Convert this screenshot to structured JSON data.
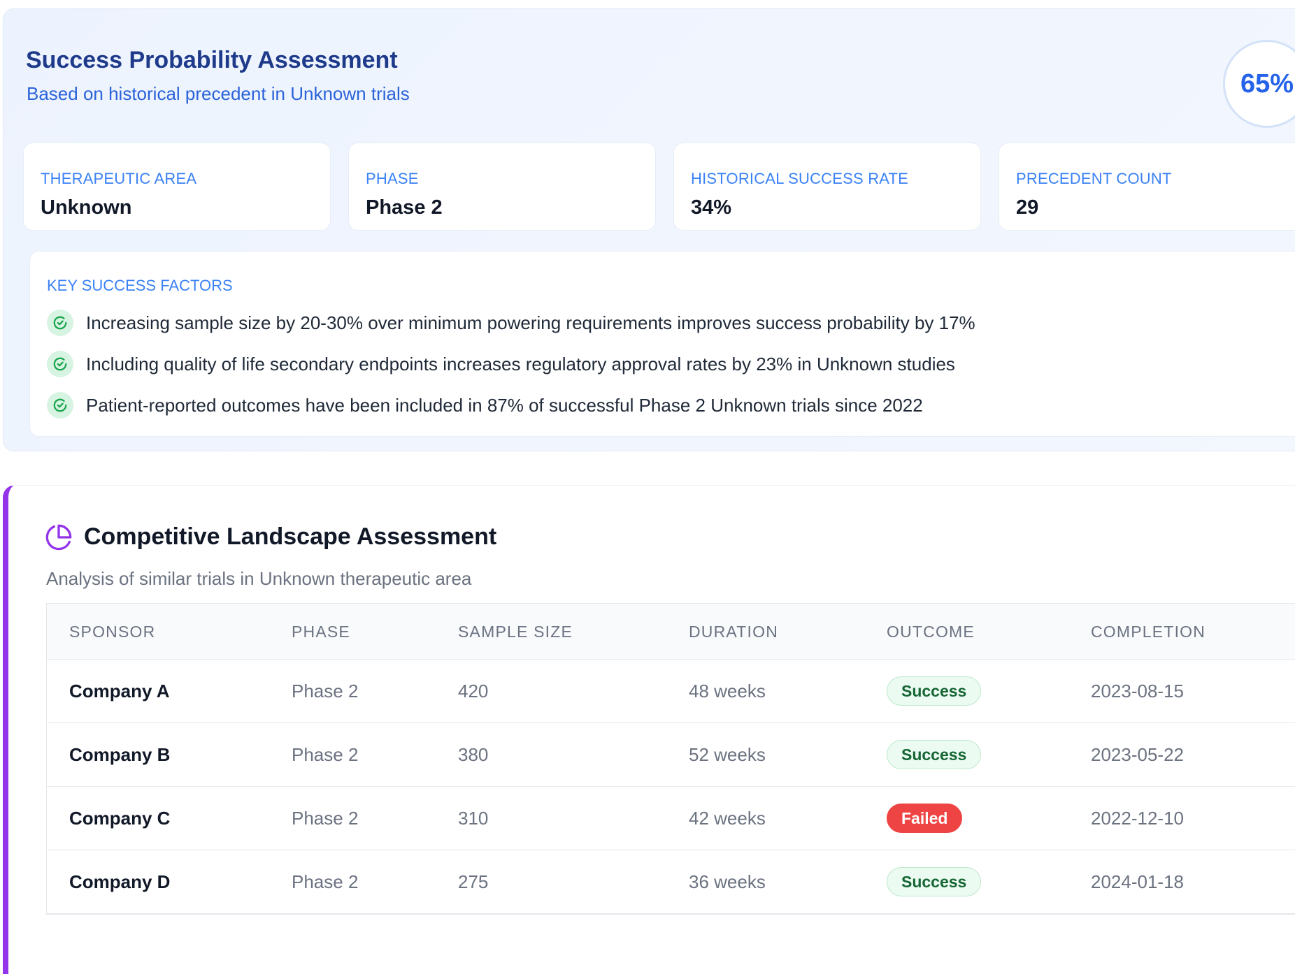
{
  "success_probability": {
    "title": "Success Probability Assessment",
    "subtitle": "Based on historical precedent in Unknown trials",
    "score": "65%",
    "metrics": [
      {
        "label": "THERAPEUTIC AREA",
        "value": "Unknown"
      },
      {
        "label": "PHASE",
        "value": "Phase 2"
      },
      {
        "label": "HISTORICAL SUCCESS RATE",
        "value": "34%"
      },
      {
        "label": "PRECEDENT COUNT",
        "value": "29"
      }
    ],
    "factors_title": "KEY SUCCESS FACTORS",
    "factors": [
      "Increasing sample size by 20-30% over minimum powering requirements improves success probability by 17%",
      "Including quality of life secondary endpoints increases regulatory approval rates by 23% in Unknown studies",
      "Patient-reported outcomes have been included in 87% of successful Phase 2 Unknown trials since 2022"
    ],
    "factor_icon": "check-circle-icon"
  },
  "competitive_landscape": {
    "icon": "pie-chart-icon",
    "title": "Competitive Landscape Assessment",
    "subtitle": "Analysis of similar trials in Unknown therapeutic area",
    "columns": [
      "SPONSOR",
      "PHASE",
      "SAMPLE SIZE",
      "DURATION",
      "OUTCOME",
      "COMPLETION"
    ],
    "rows": [
      {
        "sponsor": "Company A",
        "phase": "Phase 2",
        "sample_size": "420",
        "duration": "48 weeks",
        "outcome": "Success",
        "completion": "2023-08-15"
      },
      {
        "sponsor": "Company B",
        "phase": "Phase 2",
        "sample_size": "380",
        "duration": "52 weeks",
        "outcome": "Success",
        "completion": "2023-05-22"
      },
      {
        "sponsor": "Company C",
        "phase": "Phase 2",
        "sample_size": "310",
        "duration": "42 weeks",
        "outcome": "Failed",
        "completion": "2022-12-10"
      },
      {
        "sponsor": "Company D",
        "phase": "Phase 2",
        "sample_size": "275",
        "duration": "36 weeks",
        "outcome": "Success",
        "completion": "2024-01-18"
      }
    ]
  },
  "colors": {
    "accent_blue": "#2563eb",
    "title_navy": "#1e3a8a",
    "accent_purple": "#9333ea",
    "success_green": "#166534",
    "failed_red": "#ef4444"
  }
}
